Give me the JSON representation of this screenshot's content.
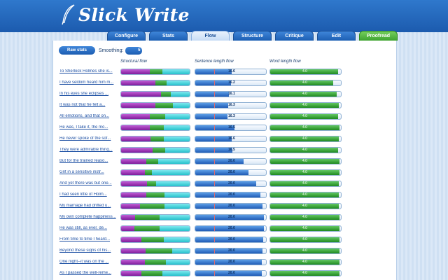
{
  "app": {
    "title": "Slick Write"
  },
  "tabs": [
    {
      "label": "Configure",
      "state": "normal"
    },
    {
      "label": "Stats",
      "state": "normal"
    },
    {
      "label": "Flow",
      "state": "active"
    },
    {
      "label": "Structure",
      "state": "normal"
    },
    {
      "label": "Critique",
      "state": "normal"
    },
    {
      "label": "Edit",
      "state": "normal"
    },
    {
      "label": "Proofread",
      "state": "green"
    }
  ],
  "controls": {
    "raw_button": "Raw stats",
    "smoothing_label": "Smoothing:",
    "smoothing_value": "5"
  },
  "columns": {
    "structural": "Structural flow",
    "sentence": "Sentence length flow",
    "word": "Word length flow"
  },
  "colors": {
    "purple": "#8e2aa8",
    "green": "#2e9a2e",
    "cyan": "#33c9d3",
    "blue": "#2a6cc7"
  },
  "rows": [
    {
      "label": "To Sherlock Holmes she is...",
      "struct": [
        0.42,
        0.18,
        0.4
      ],
      "sentence_pct": 0.51,
      "sentence_val": "16.6",
      "word_pct": 0.96,
      "word_val": "4.0"
    },
    {
      "label": "I have seldom heard him m...",
      "struct": [
        0.5,
        0.16,
        0.34
      ],
      "sentence_pct": 0.5,
      "sentence_val": "16.2",
      "word_pct": 0.89,
      "word_val": "4.0"
    },
    {
      "label": "In his eyes she eclipses ...",
      "struct": [
        0.58,
        0.14,
        0.28
      ],
      "sentence_pct": 0.48,
      "sentence_val": "16.1",
      "word_pct": 0.94,
      "word_val": "4.0"
    },
    {
      "label": "It was not that he felt a...",
      "struct": [
        0.5,
        0.26,
        0.24
      ],
      "sentence_pct": 0.47,
      "sentence_val": "16.3",
      "word_pct": 0.97,
      "word_val": "4.0"
    },
    {
      "label": "All emotions, and that on...",
      "struct": [
        0.42,
        0.22,
        0.36
      ],
      "sentence_pct": 0.46,
      "sentence_val": "16.3",
      "word_pct": 0.96,
      "word_val": "4.0"
    },
    {
      "label": "He was, I take it, the mo...",
      "struct": [
        0.42,
        0.2,
        0.38
      ],
      "sentence_pct": 0.55,
      "sentence_val": "16.5",
      "word_pct": 0.98,
      "word_val": "4.0"
    },
    {
      "label": "He never spoke of the sof...",
      "struct": [
        0.43,
        0.19,
        0.38
      ],
      "sentence_pct": 0.51,
      "sentence_val": "16.6",
      "word_pct": 0.97,
      "word_val": "4.0"
    },
    {
      "label": "They were admirable thing...",
      "struct": [
        0.46,
        0.18,
        0.36
      ],
      "sentence_pct": 0.52,
      "sentence_val": "16.5",
      "word_pct": 0.96,
      "word_val": "4.0"
    },
    {
      "label": "But for the trained reaso...",
      "struct": [
        0.37,
        0.17,
        0.46
      ],
      "sentence_pct": 0.68,
      "sentence_val": "20.0",
      "word_pct": 0.98,
      "word_val": "4.0"
    },
    {
      "label": "Grit in a sensitive instr...",
      "struct": [
        0.35,
        0.1,
        0.55
      ],
      "sentence_pct": 0.75,
      "sentence_val": "20.0",
      "word_pct": 0.98,
      "word_val": "4.0"
    },
    {
      "label": "And yet there was but one...",
      "struct": [
        0.38,
        0.13,
        0.49
      ],
      "sentence_pct": 0.86,
      "sentence_val": "20.0",
      "word_pct": 0.97,
      "word_val": "4.0"
    },
    {
      "label": "I had seen little of Holm...",
      "struct": [
        0.37,
        0.26,
        0.37
      ],
      "sentence_pct": 0.92,
      "sentence_val": "20.0",
      "word_pct": 0.97,
      "word_val": "4.0"
    },
    {
      "label": "My marriage had drifted u...",
      "struct": [
        0.28,
        0.35,
        0.37
      ],
      "sentence_pct": 0.95,
      "sentence_val": "20.0",
      "word_pct": 0.97,
      "word_val": "4.0"
    },
    {
      "label": "My own complete happiness...",
      "struct": [
        0.2,
        0.36,
        0.44
      ],
      "sentence_pct": 0.97,
      "sentence_val": "20.0",
      "word_pct": 0.98,
      "word_val": "4.0"
    },
    {
      "label": "He was still, as ever, de...",
      "struct": [
        0.19,
        0.37,
        0.44
      ],
      "sentence_pct": 0.97,
      "sentence_val": "20.0",
      "word_pct": 0.98,
      "word_val": "4.0"
    },
    {
      "label": "From time to time I heard...",
      "struct": [
        0.3,
        0.32,
        0.38
      ],
      "sentence_pct": 0.96,
      "sentence_val": "20.0",
      "word_pct": 0.98,
      "word_val": "4.0"
    },
    {
      "label": "Beyond these signs of his...",
      "struct": [
        0.36,
        0.38,
        0.26
      ],
      "sentence_pct": 0.95,
      "sentence_val": "20.0",
      "word_pct": 0.98,
      "word_val": "4.0"
    },
    {
      "label": "One night--it was on the ...",
      "struct": [
        0.35,
        0.3,
        0.35
      ],
      "sentence_pct": 0.94,
      "sentence_val": "20.0",
      "word_pct": 0.98,
      "word_val": "4.0"
    },
    {
      "label": "As I passed the well-reme...",
      "struct": [
        0.3,
        0.3,
        0.4
      ],
      "sentence_pct": 0.94,
      "sentence_val": "20.0",
      "word_pct": 0.98,
      "word_val": "4.0"
    }
  ]
}
